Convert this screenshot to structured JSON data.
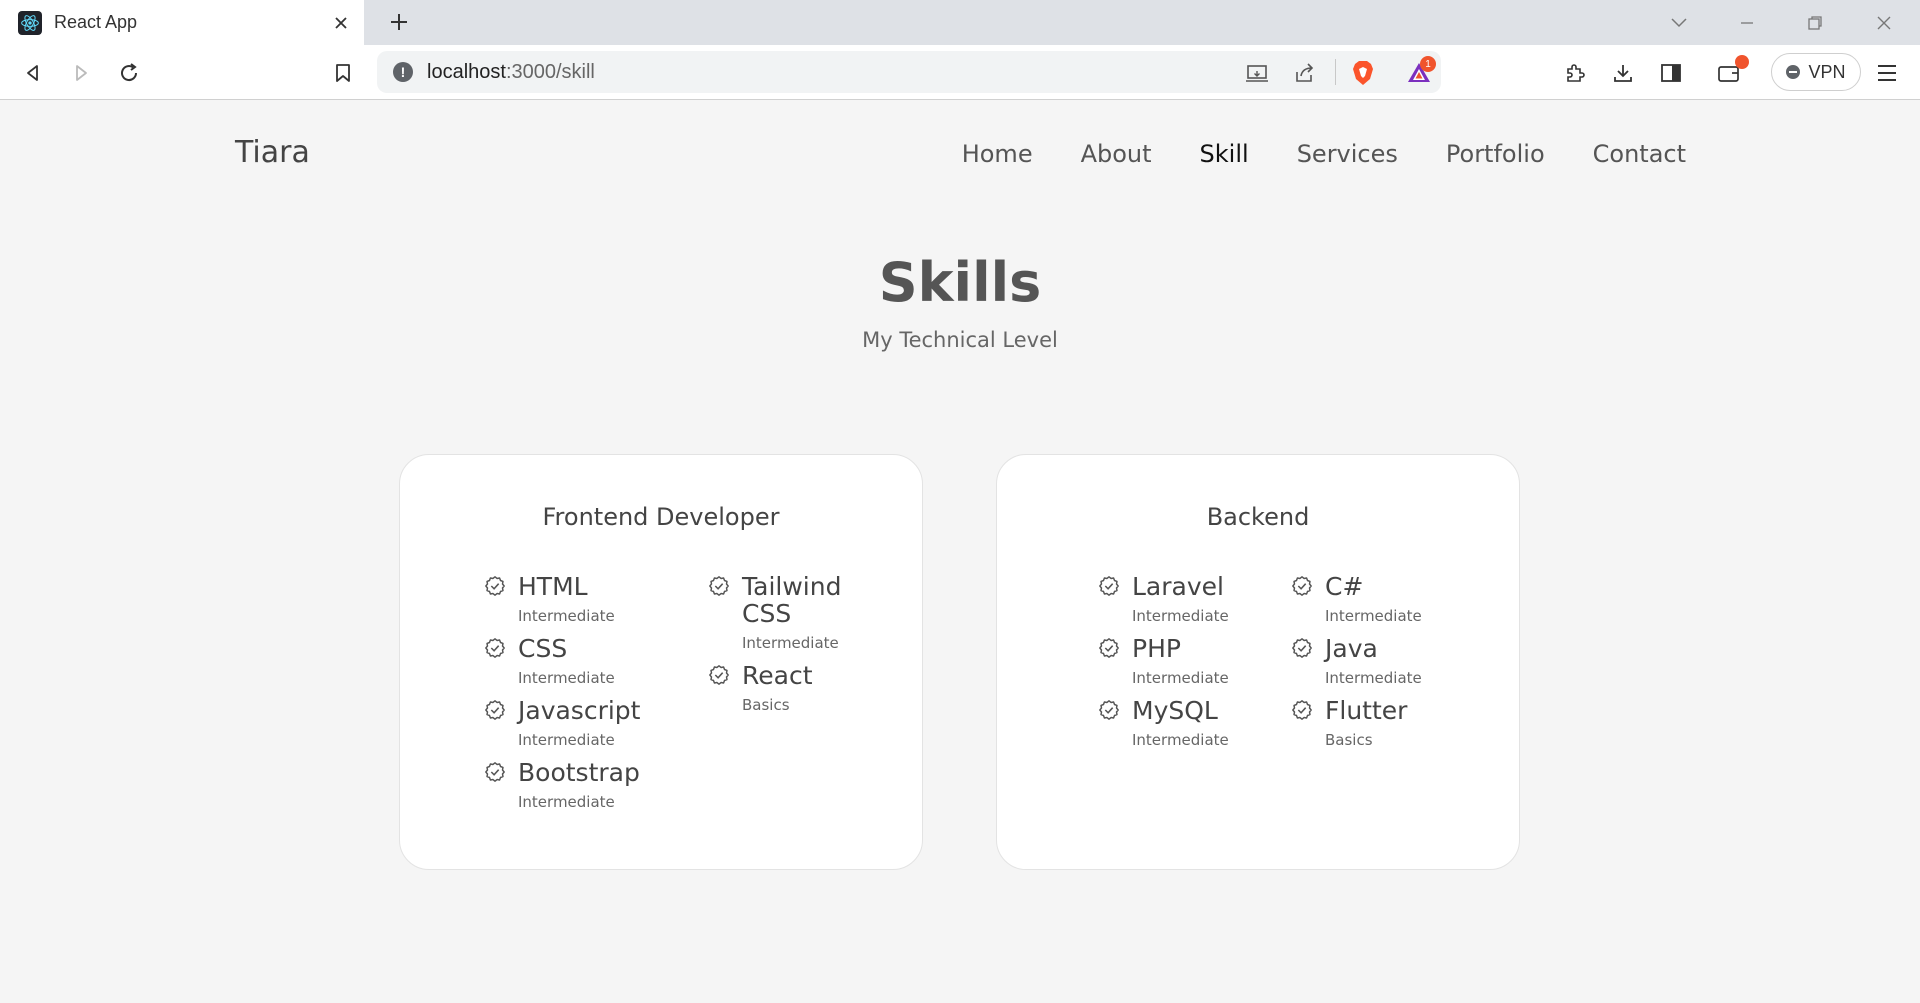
{
  "browser": {
    "tab_title": "React App",
    "url_host": "localhost",
    "url_path": ":3000/skill",
    "vpn_label": "VPN",
    "notification_count": "1"
  },
  "site": {
    "logo": "Tiara",
    "nav": [
      {
        "label": "Home",
        "active": false
      },
      {
        "label": "About",
        "active": false
      },
      {
        "label": "Skill",
        "active": true
      },
      {
        "label": "Services",
        "active": false
      },
      {
        "label": "Portfolio",
        "active": false
      },
      {
        "label": "Contact",
        "active": false
      }
    ]
  },
  "skills_section": {
    "title": "Skills",
    "subtitle": "My Technical Level",
    "cards": [
      {
        "title": "Frontend Developer",
        "columns": [
          [
            {
              "name": "HTML",
              "level": "Intermediate"
            },
            {
              "name": "CSS",
              "level": "Intermediate"
            },
            {
              "name": "Javascript",
              "level": "Intermediate"
            },
            {
              "name": "Bootstrap",
              "level": "Intermediate"
            }
          ],
          [
            {
              "name": "Tailwind CSS",
              "level": "Intermediate"
            },
            {
              "name": "React",
              "level": "Basics"
            }
          ]
        ]
      },
      {
        "title": "Backend",
        "columns": [
          [
            {
              "name": "Laravel",
              "level": "Intermediate"
            },
            {
              "name": "PHP",
              "level": "Intermediate"
            },
            {
              "name": "MySQL",
              "level": "Intermediate"
            }
          ],
          [
            {
              "name": "C#",
              "level": "Intermediate"
            },
            {
              "name": "Java",
              "level": "Intermediate"
            },
            {
              "name": "Flutter",
              "level": "Basics"
            }
          ]
        ]
      }
    ]
  }
}
